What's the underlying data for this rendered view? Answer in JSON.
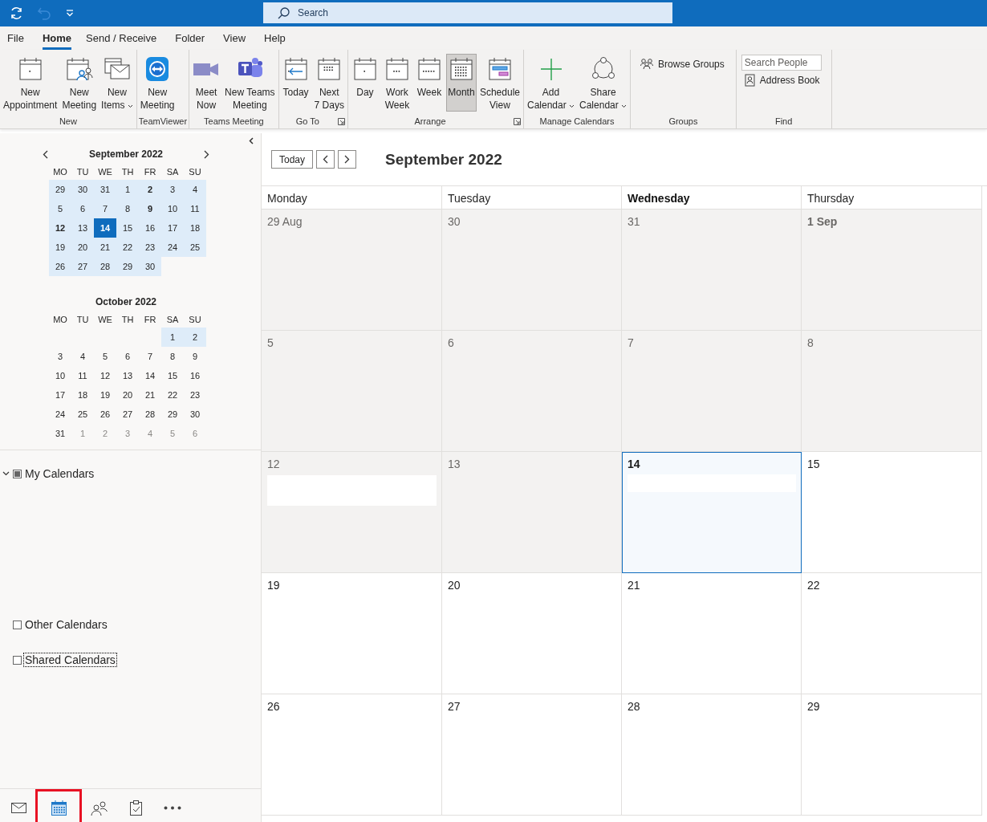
{
  "title_bar": {
    "search_placeholder": "Search",
    "undo_disabled": true
  },
  "ribbon_tabs": [
    {
      "label": "File",
      "selected": false
    },
    {
      "label": "Home",
      "selected": true
    },
    {
      "label": "Send / Receive",
      "selected": false
    },
    {
      "label": "Folder",
      "selected": false
    },
    {
      "label": "View",
      "selected": false
    },
    {
      "label": "Help",
      "selected": false
    }
  ],
  "ribbon_groups": [
    {
      "label": "New",
      "launcher": false,
      "items": [
        {
          "kind": "appointment",
          "lines": [
            "New",
            "Appointment"
          ],
          "dropdown": false
        },
        {
          "kind": "meeting",
          "lines": [
            "New",
            "Meeting"
          ],
          "dropdown": false
        },
        {
          "kind": "items",
          "lines": [
            "New",
            "Items"
          ],
          "dropdown": true
        }
      ]
    },
    {
      "label": "TeamViewer",
      "launcher": false,
      "items": [
        {
          "kind": "teamviewer",
          "lines": [
            "New",
            "Meeting"
          ],
          "dropdown": false
        }
      ]
    },
    {
      "label": "Teams Meeting",
      "launcher": false,
      "items": [
        {
          "kind": "video",
          "lines": [
            "Meet",
            "Now"
          ],
          "dropdown": false
        },
        {
          "kind": "teams",
          "lines": [
            "New Teams",
            "Meeting"
          ],
          "dropdown": false
        }
      ]
    },
    {
      "label": "Go To",
      "launcher": true,
      "items": [
        {
          "kind": "today",
          "lines": [
            "Today"
          ],
          "dropdown": false
        },
        {
          "kind": "next7",
          "lines": [
            "Next",
            "7 Days"
          ],
          "dropdown": false
        }
      ]
    },
    {
      "label": "Arrange",
      "launcher": true,
      "items": [
        {
          "kind": "day",
          "lines": [
            "Day"
          ],
          "dropdown": false,
          "selected": false
        },
        {
          "kind": "workweek",
          "lines": [
            "Work",
            "Week"
          ],
          "dropdown": false,
          "selected": false
        },
        {
          "kind": "week",
          "lines": [
            "Week"
          ],
          "dropdown": false,
          "selected": false
        },
        {
          "kind": "month",
          "lines": [
            "Month"
          ],
          "dropdown": false,
          "selected": true
        },
        {
          "kind": "schedule",
          "lines": [
            "Schedule",
            "View"
          ],
          "dropdown": false,
          "selected": false
        }
      ]
    },
    {
      "label": "Manage Calendars",
      "launcher": false,
      "items": [
        {
          "kind": "add",
          "lines": [
            "Add",
            "Calendar"
          ],
          "dropdown": true
        },
        {
          "kind": "share",
          "lines": [
            "Share",
            "Calendar"
          ],
          "dropdown": true
        }
      ]
    },
    {
      "label": "Groups",
      "launcher": false,
      "items": [
        {
          "kind": "groups",
          "label": "Browse Groups"
        }
      ]
    },
    {
      "label": "Find",
      "launcher": false,
      "items": [
        {
          "kind": "field",
          "placeholder": "Search People"
        },
        {
          "kind": "book",
          "label": "Address Book"
        }
      ]
    }
  ],
  "date_navigator": [
    {
      "title": "September 2022",
      "arrows": true,
      "weekdays": [
        "MO",
        "TU",
        "WE",
        "TH",
        "FR",
        "SA",
        "SU"
      ],
      "weeks": [
        [
          {
            "kind": "day",
            "text": "29",
            "selected": false,
            "highlighted": true,
            "bold": false,
            "dim": false
          },
          {
            "kind": "day",
            "text": "30",
            "selected": false,
            "highlighted": true,
            "bold": false,
            "dim": false
          },
          {
            "kind": "day",
            "text": "31",
            "selected": false,
            "highlighted": true,
            "bold": false,
            "dim": false
          },
          {
            "kind": "day",
            "text": "1",
            "selected": false,
            "highlighted": true,
            "bold": false,
            "dim": false
          },
          {
            "kind": "day",
            "text": "2",
            "selected": false,
            "highlighted": true,
            "bold": true,
            "dim": false
          },
          {
            "kind": "day",
            "text": "3",
            "selected": false,
            "highlighted": true,
            "bold": false,
            "dim": false
          },
          {
            "kind": "day",
            "text": "4",
            "selected": false,
            "highlighted": true,
            "bold": false,
            "dim": false
          }
        ],
        [
          {
            "kind": "day",
            "text": "5",
            "selected": false,
            "highlighted": true,
            "bold": false,
            "dim": false
          },
          {
            "kind": "day",
            "text": "6",
            "selected": false,
            "highlighted": true,
            "bold": false,
            "dim": false
          },
          {
            "kind": "day",
            "text": "7",
            "selected": false,
            "highlighted": true,
            "bold": false,
            "dim": false
          },
          {
            "kind": "day",
            "text": "8",
            "selected": false,
            "highlighted": true,
            "bold": false,
            "dim": false
          },
          {
            "kind": "day",
            "text": "9",
            "selected": false,
            "highlighted": true,
            "bold": true,
            "dim": false
          },
          {
            "kind": "day",
            "text": "10",
            "selected": false,
            "highlighted": true,
            "bold": false,
            "dim": false
          },
          {
            "kind": "day",
            "text": "11",
            "selected": false,
            "highlighted": true,
            "bold": false,
            "dim": false
          }
        ],
        [
          {
            "kind": "day",
            "text": "12",
            "selected": false,
            "highlighted": true,
            "bold": true,
            "dim": false
          },
          {
            "kind": "day",
            "text": "13",
            "selected": false,
            "highlighted": true,
            "bold": false,
            "dim": false
          },
          {
            "kind": "day",
            "text": "14",
            "selected": true,
            "highlighted": true,
            "bold": true,
            "dim": false
          },
          {
            "kind": "day",
            "text": "15",
            "selected": false,
            "highlighted": true,
            "bold": false,
            "dim": false
          },
          {
            "kind": "day",
            "text": "16",
            "selected": false,
            "highlighted": true,
            "bold": false,
            "dim": false
          },
          {
            "kind": "day",
            "text": "17",
            "selected": false,
            "highlighted": true,
            "bold": false,
            "dim": false
          },
          {
            "kind": "day",
            "text": "18",
            "selected": false,
            "highlighted": true,
            "bold": false,
            "dim": false
          }
        ],
        [
          {
            "kind": "day",
            "text": "19",
            "selected": false,
            "highlighted": true,
            "bold": false,
            "dim": false
          },
          {
            "kind": "day",
            "text": "20",
            "selected": false,
            "highlighted": true,
            "bold": false,
            "dim": false
          },
          {
            "kind": "day",
            "text": "21",
            "selected": false,
            "highlighted": true,
            "bold": false,
            "dim": false
          },
          {
            "kind": "day",
            "text": "22",
            "selected": false,
            "highlighted": true,
            "bold": false,
            "dim": false
          },
          {
            "kind": "day",
            "text": "23",
            "selected": false,
            "highlighted": true,
            "bold": false,
            "dim": false
          },
          {
            "kind": "day",
            "text": "24",
            "selected": false,
            "highlighted": true,
            "bold": false,
            "dim": false
          },
          {
            "kind": "day",
            "text": "25",
            "selected": false,
            "highlighted": true,
            "bold": false,
            "dim": false
          }
        ],
        [
          {
            "kind": "day",
            "text": "26",
            "selected": false,
            "highlighted": true,
            "bold": false,
            "dim": false
          },
          {
            "kind": "day",
            "text": "27",
            "selected": false,
            "highlighted": true,
            "bold": false,
            "dim": false
          },
          {
            "kind": "day",
            "text": "28",
            "selected": false,
            "highlighted": true,
            "bold": false,
            "dim": false
          },
          {
            "kind": "day",
            "text": "29",
            "selected": false,
            "highlighted": true,
            "bold": false,
            "dim": false
          },
          {
            "kind": "day",
            "text": "30",
            "selected": false,
            "highlighted": true,
            "bold": false,
            "dim": false
          }
        ]
      ]
    },
    {
      "title": "October 2022",
      "arrows": false,
      "weekdays": [
        "MO",
        "TU",
        "WE",
        "TH",
        "FR",
        "SA",
        "SU"
      ],
      "weeks": [
        [
          {
            "kind": "blank"
          },
          {
            "kind": "blank"
          },
          {
            "kind": "blank"
          },
          {
            "kind": "blank"
          },
          {
            "kind": "blank"
          },
          {
            "kind": "day",
            "text": "1",
            "selected": false,
            "highlighted": true,
            "bold": false,
            "dim": false
          },
          {
            "kind": "day",
            "text": "2",
            "selected": false,
            "highlighted": true,
            "bold": false,
            "dim": false
          }
        ],
        [
          {
            "kind": "day",
            "text": "3",
            "selected": false,
            "highlighted": false,
            "bold": false,
            "dim": false
          },
          {
            "kind": "day",
            "text": "4",
            "selected": false,
            "highlighted": false,
            "bold": false,
            "dim": false
          },
          {
            "kind": "day",
            "text": "5",
            "selected": false,
            "highlighted": false,
            "bold": false,
            "dim": false
          },
          {
            "kind": "day",
            "text": "6",
            "selected": false,
            "highlighted": false,
            "bold": false,
            "dim": false
          },
          {
            "kind": "day",
            "text": "7",
            "selected": false,
            "highlighted": false,
            "bold": false,
            "dim": false
          },
          {
            "kind": "day",
            "text": "8",
            "selected": false,
            "highlighted": false,
            "bold": false,
            "dim": false
          },
          {
            "kind": "day",
            "text": "9",
            "selected": false,
            "highlighted": false,
            "bold": false,
            "dim": false
          }
        ],
        [
          {
            "kind": "day",
            "text": "10",
            "selected": false,
            "highlighted": false,
            "bold": false,
            "dim": false
          },
          {
            "kind": "day",
            "text": "11",
            "selected": false,
            "highlighted": false,
            "bold": false,
            "dim": false
          },
          {
            "kind": "day",
            "text": "12",
            "selected": false,
            "highlighted": false,
            "bold": false,
            "dim": false
          },
          {
            "kind": "day",
            "text": "13",
            "selected": false,
            "highlighted": false,
            "bold": false,
            "dim": false
          },
          {
            "kind": "day",
            "text": "14",
            "selected": false,
            "highlighted": false,
            "bold": false,
            "dim": false
          },
          {
            "kind": "day",
            "text": "15",
            "selected": false,
            "highlighted": false,
            "bold": false,
            "dim": false
          },
          {
            "kind": "day",
            "text": "16",
            "selected": false,
            "highlighted": false,
            "bold": false,
            "dim": false
          }
        ],
        [
          {
            "kind": "day",
            "text": "17",
            "selected": false,
            "highlighted": false,
            "bold": false,
            "dim": false
          },
          {
            "kind": "day",
            "text": "18",
            "selected": false,
            "highlighted": false,
            "bold": false,
            "dim": false
          },
          {
            "kind": "day",
            "text": "19",
            "selected": false,
            "highlighted": false,
            "bold": false,
            "dim": false
          },
          {
            "kind": "day",
            "text": "20",
            "selected": false,
            "highlighted": false,
            "bold": false,
            "dim": false
          },
          {
            "kind": "day",
            "text": "21",
            "selected": false,
            "highlighted": false,
            "bold": false,
            "dim": false
          },
          {
            "kind": "day",
            "text": "22",
            "selected": false,
            "highlighted": false,
            "bold": false,
            "dim": false
          },
          {
            "kind": "day",
            "text": "23",
            "selected": false,
            "highlighted": false,
            "bold": false,
            "dim": false
          }
        ],
        [
          {
            "kind": "day",
            "text": "24",
            "selected": false,
            "highlighted": false,
            "bold": false,
            "dim": false
          },
          {
            "kind": "day",
            "text": "25",
            "selected": false,
            "highlighted": false,
            "bold": false,
            "dim": false
          },
          {
            "kind": "day",
            "text": "26",
            "selected": false,
            "highlighted": false,
            "bold": false,
            "dim": false
          },
          {
            "kind": "day",
            "text": "27",
            "selected": false,
            "highlighted": false,
            "bold": false,
            "dim": false
          },
          {
            "kind": "day",
            "text": "28",
            "selected": false,
            "highlighted": false,
            "bold": false,
            "dim": false
          },
          {
            "kind": "day",
            "text": "29",
            "selected": false,
            "highlighted": false,
            "bold": false,
            "dim": false
          },
          {
            "kind": "day",
            "text": "30",
            "selected": false,
            "highlighted": false,
            "bold": false,
            "dim": false
          }
        ],
        [
          {
            "kind": "day",
            "text": "31",
            "selected": false,
            "highlighted": false,
            "bold": false,
            "dim": false
          },
          {
            "kind": "day",
            "text": "1",
            "selected": false,
            "highlighted": false,
            "bold": false,
            "dim": true
          },
          {
            "kind": "day",
            "text": "2",
            "selected": false,
            "highlighted": false,
            "bold": false,
            "dim": true
          },
          {
            "kind": "day",
            "text": "3",
            "selected": false,
            "highlighted": false,
            "bold": false,
            "dim": true
          },
          {
            "kind": "day",
            "text": "4",
            "selected": false,
            "highlighted": false,
            "bold": false,
            "dim": true
          },
          {
            "kind": "day",
            "text": "5",
            "selected": false,
            "highlighted": false,
            "bold": false,
            "dim": true
          },
          {
            "kind": "day",
            "text": "6",
            "selected": false,
            "highlighted": false,
            "bold": false,
            "dim": true
          }
        ]
      ]
    }
  ],
  "calendar_folders": [
    {
      "label": "My Calendars",
      "expanded": true,
      "checked": false,
      "indeterminate": true,
      "focused": false
    },
    {
      "label": "Other Calendars",
      "expanded": false,
      "checked": false,
      "indeterminate": false,
      "focused": false
    },
    {
      "label": "Shared Calendars",
      "expanded": false,
      "checked": false,
      "indeterminate": false,
      "focused": true
    }
  ],
  "nav_bar": [
    {
      "kind": "mail",
      "selected": false,
      "annotated": false
    },
    {
      "kind": "calendar",
      "selected": true,
      "annotated": true
    },
    {
      "kind": "people",
      "selected": false,
      "annotated": false
    },
    {
      "kind": "tasks",
      "selected": false,
      "annotated": false
    },
    {
      "kind": "more",
      "selected": false,
      "annotated": false
    }
  ],
  "calendar": {
    "today_button": "Today",
    "title": "September 2022",
    "day_headers": [
      {
        "label": "Monday",
        "today": false
      },
      {
        "label": "Tuesday",
        "today": false
      },
      {
        "label": "Wednesday",
        "today": true
      },
      {
        "label": "Thursday",
        "today": false
      }
    ],
    "weeks": [
      [
        {
          "label": "29 Aug",
          "bold": false,
          "past": true,
          "selected": false,
          "event": false
        },
        {
          "label": "30",
          "bold": false,
          "past": true,
          "selected": false,
          "event": false
        },
        {
          "label": "31",
          "bold": false,
          "past": true,
          "selected": false,
          "event": false
        },
        {
          "label": "1 Sep",
          "bold": true,
          "past": true,
          "selected": false,
          "event": false
        }
      ],
      [
        {
          "label": "5",
          "bold": false,
          "past": true,
          "selected": false,
          "event": false
        },
        {
          "label": "6",
          "bold": false,
          "past": true,
          "selected": false,
          "event": false
        },
        {
          "label": "7",
          "bold": false,
          "past": true,
          "selected": false,
          "event": false
        },
        {
          "label": "8",
          "bold": false,
          "past": true,
          "selected": false,
          "event": false
        }
      ],
      [
        {
          "label": "12",
          "bold": false,
          "past": true,
          "selected": false,
          "event": true
        },
        {
          "label": "13",
          "bold": false,
          "past": true,
          "selected": false,
          "event": false
        },
        {
          "label": "14",
          "bold": true,
          "past": false,
          "selected": true,
          "event": true
        },
        {
          "label": "15",
          "bold": false,
          "past": false,
          "selected": false,
          "event": false
        }
      ],
      [
        {
          "label": "19",
          "bold": false,
          "past": false,
          "selected": false,
          "event": false
        },
        {
          "label": "20",
          "bold": false,
          "past": false,
          "selected": false,
          "event": false
        },
        {
          "label": "21",
          "bold": false,
          "past": false,
          "selected": false,
          "event": false
        },
        {
          "label": "22",
          "bold": false,
          "past": false,
          "selected": false,
          "event": false
        }
      ],
      [
        {
          "label": "26",
          "bold": false,
          "past": false,
          "selected": false,
          "event": false
        },
        {
          "label": "27",
          "bold": false,
          "past": false,
          "selected": false,
          "event": false
        },
        {
          "label": "28",
          "bold": false,
          "past": false,
          "selected": false,
          "event": false
        },
        {
          "label": "29",
          "bold": false,
          "past": false,
          "selected": false,
          "event": false
        }
      ]
    ]
  }
}
